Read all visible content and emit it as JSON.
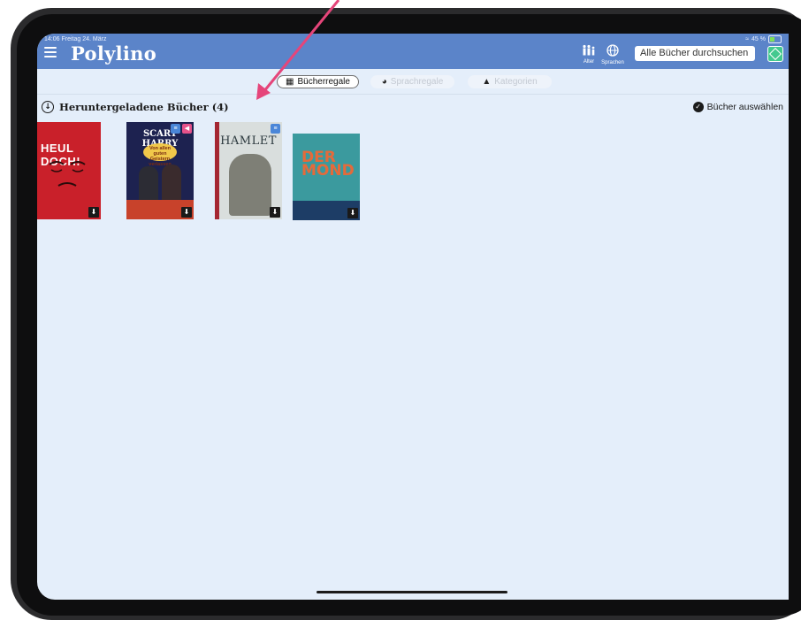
{
  "status_bar": {
    "time": "14:06",
    "date": "Freitag 24. März",
    "battery": "45 %"
  },
  "header": {
    "logo": "Polylino",
    "age_label": "Alter",
    "languages_label": "Sprachen",
    "search_placeholder": "Alle Bücher durchsuchen"
  },
  "tabs": [
    {
      "label": "Bücherregale",
      "active": true,
      "icon": "grid-icon"
    },
    {
      "label": "Sprachregale",
      "active": false,
      "icon": "globe-icon"
    },
    {
      "label": "Kategorien",
      "active": false,
      "icon": "shapes-icon"
    }
  ],
  "section": {
    "title": "Heruntergeladene Bücher (4)",
    "select_label": "Bücher auswählen"
  },
  "books": [
    {
      "title": "HEUL DOCH!"
    },
    {
      "title": "SCARY HARRY",
      "subtitle": "Von allen guten Geistern verlassen"
    },
    {
      "title": "HAMLET"
    },
    {
      "title": "DER MOND"
    }
  ],
  "colors": {
    "header_bg": "#5b84c9",
    "screen_bg": "#e4eefa",
    "annotation_arrow": "#e5457a"
  }
}
